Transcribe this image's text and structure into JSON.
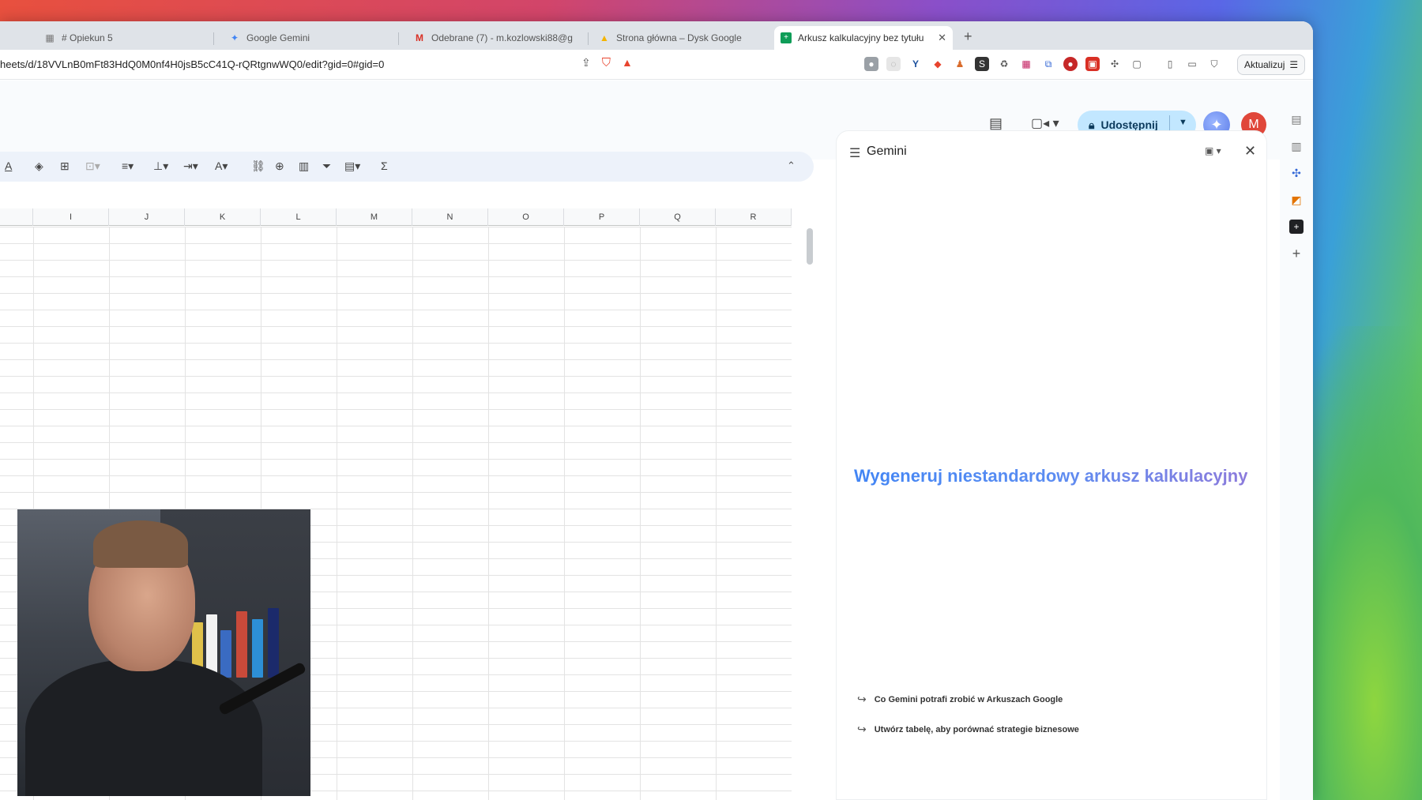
{
  "tabs": [
    {
      "label": "# Opiekun 5",
      "icon": "grid-icon"
    },
    {
      "label": "Google Gemini",
      "icon": "gemini-icon"
    },
    {
      "label": "Odebrane (7) - m.kozlowski88@g",
      "icon": "gmail-icon"
    },
    {
      "label": "Strona główna – Dysk Google",
      "icon": "drive-icon"
    },
    {
      "label": "Arkusz kalkulacyjny bez tytułu",
      "icon": "sheets-icon",
      "active": true
    }
  ],
  "address": {
    "url": "heets/d/18VVLnB0mFt83HdQ0M0nf4H0jsB5cC41Q-rQRtgnwWQ0/edit?gid=0#gid=0",
    "update_label": "Aktualizuj"
  },
  "header": {
    "share_label": "Udostępnij",
    "avatar_letter": "M"
  },
  "columns": [
    "I",
    "J",
    "K",
    "L",
    "M",
    "N",
    "O",
    "P",
    "Q",
    "R"
  ],
  "gemini_panel": {
    "title": "Gemini",
    "headline": "Wygeneruj niestandardowy arkusz kalkulacyjny",
    "suggestions": [
      "Co Gemini potrafi zrobić w Arkuszach Google",
      "Utwórz tabelę, aby porównać strategie biznesowe"
    ]
  },
  "colors": {
    "share_bg": "#c2e7ff",
    "avatar_bg": "#e0473a",
    "headline_start": "#4285f4",
    "headline_end": "#8c7bdc"
  }
}
